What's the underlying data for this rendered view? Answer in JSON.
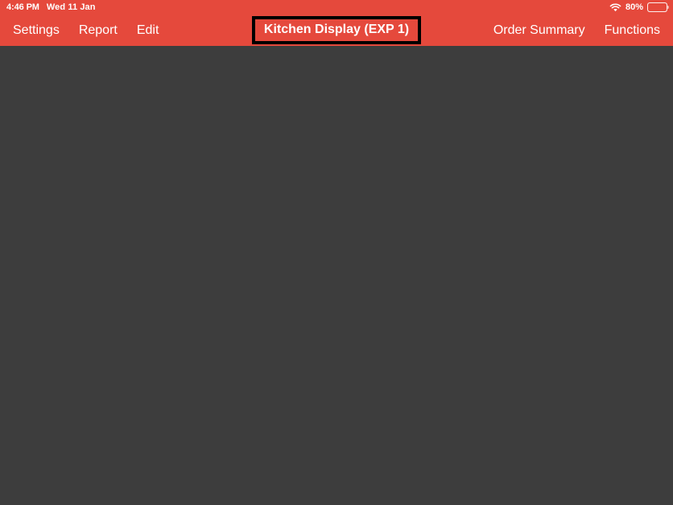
{
  "status_bar": {
    "time": "4:46 PM",
    "date": "Wed 11 Jan",
    "wifi_icon": "wifi-icon",
    "battery_percent": "80%",
    "battery_level": 80,
    "battery_icon": "battery-icon"
  },
  "nav_bar": {
    "background_color": "#e5493c",
    "text_color": "#ffffff",
    "left_items": [
      {
        "label": "Settings"
      },
      {
        "label": "Report"
      },
      {
        "label": "Edit"
      }
    ],
    "title": {
      "label": "Kitchen Display (EXP 1)",
      "focus_outline_color": "#000000",
      "focused": true
    },
    "right_items": [
      {
        "label": "Order Summary"
      },
      {
        "label": "Functions"
      }
    ]
  },
  "content": {
    "background_color": "#3d3d3d",
    "items": []
  }
}
